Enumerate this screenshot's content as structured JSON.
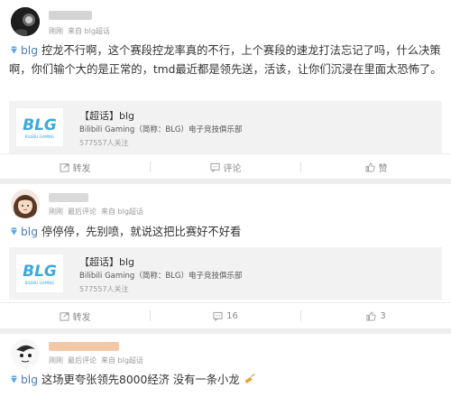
{
  "posts": [
    {
      "meta": {
        "time": "刚刚",
        "source": "来自 blg超话"
      },
      "tag": "blg",
      "text": "控龙不行啊，这个赛段控龙率真的不行，上个赛段的速龙打法忘记了吗，什么决策啊，你们输个大的是正常的，tmd最近都是领先送，活该，让你们沉浸在里面太恐怖了。",
      "topic": {
        "title": "【超话】blg",
        "subtitle": "Bilibili Gaming（简称：BLG）电子竞技俱乐部",
        "followers": "577557人关注",
        "logo_text": "BLG",
        "logo_caption": "BILIBILI GAMING"
      },
      "actions": {
        "repost": "转发",
        "comment": "评论",
        "like": "赞"
      }
    },
    {
      "meta": {
        "time": "刚刚",
        "extra": "最后评论",
        "source": "来自 blg超话"
      },
      "tag": "blg",
      "text": "停停停，先别喷，就说这把比赛好不好看",
      "topic": {
        "title": "【超话】blg",
        "subtitle": "Bilibili Gaming（简称：BLG）电子竞技俱乐部",
        "followers": "577557人关注",
        "logo_text": "BLG",
        "logo_caption": "BILIBILI GAMING"
      },
      "actions": {
        "repost": "转发",
        "comment": "16",
        "like": "3"
      }
    },
    {
      "meta": {
        "time": "刚刚",
        "extra": "最后评论",
        "source": "来自 blg超话"
      },
      "tag": "blg",
      "text": "这场更夸张领先8000经济 没有一条小龙"
    }
  ],
  "colors": {
    "tag": "#4f7cb2",
    "logo": "#3aa9dd",
    "background": "#eeeeee"
  },
  "icons": {
    "repost": "repost-icon",
    "comment": "comment-icon",
    "like": "thumbs-up-icon",
    "tag": "diamond-icon",
    "emoji": "firecracker-emoji-icon"
  }
}
